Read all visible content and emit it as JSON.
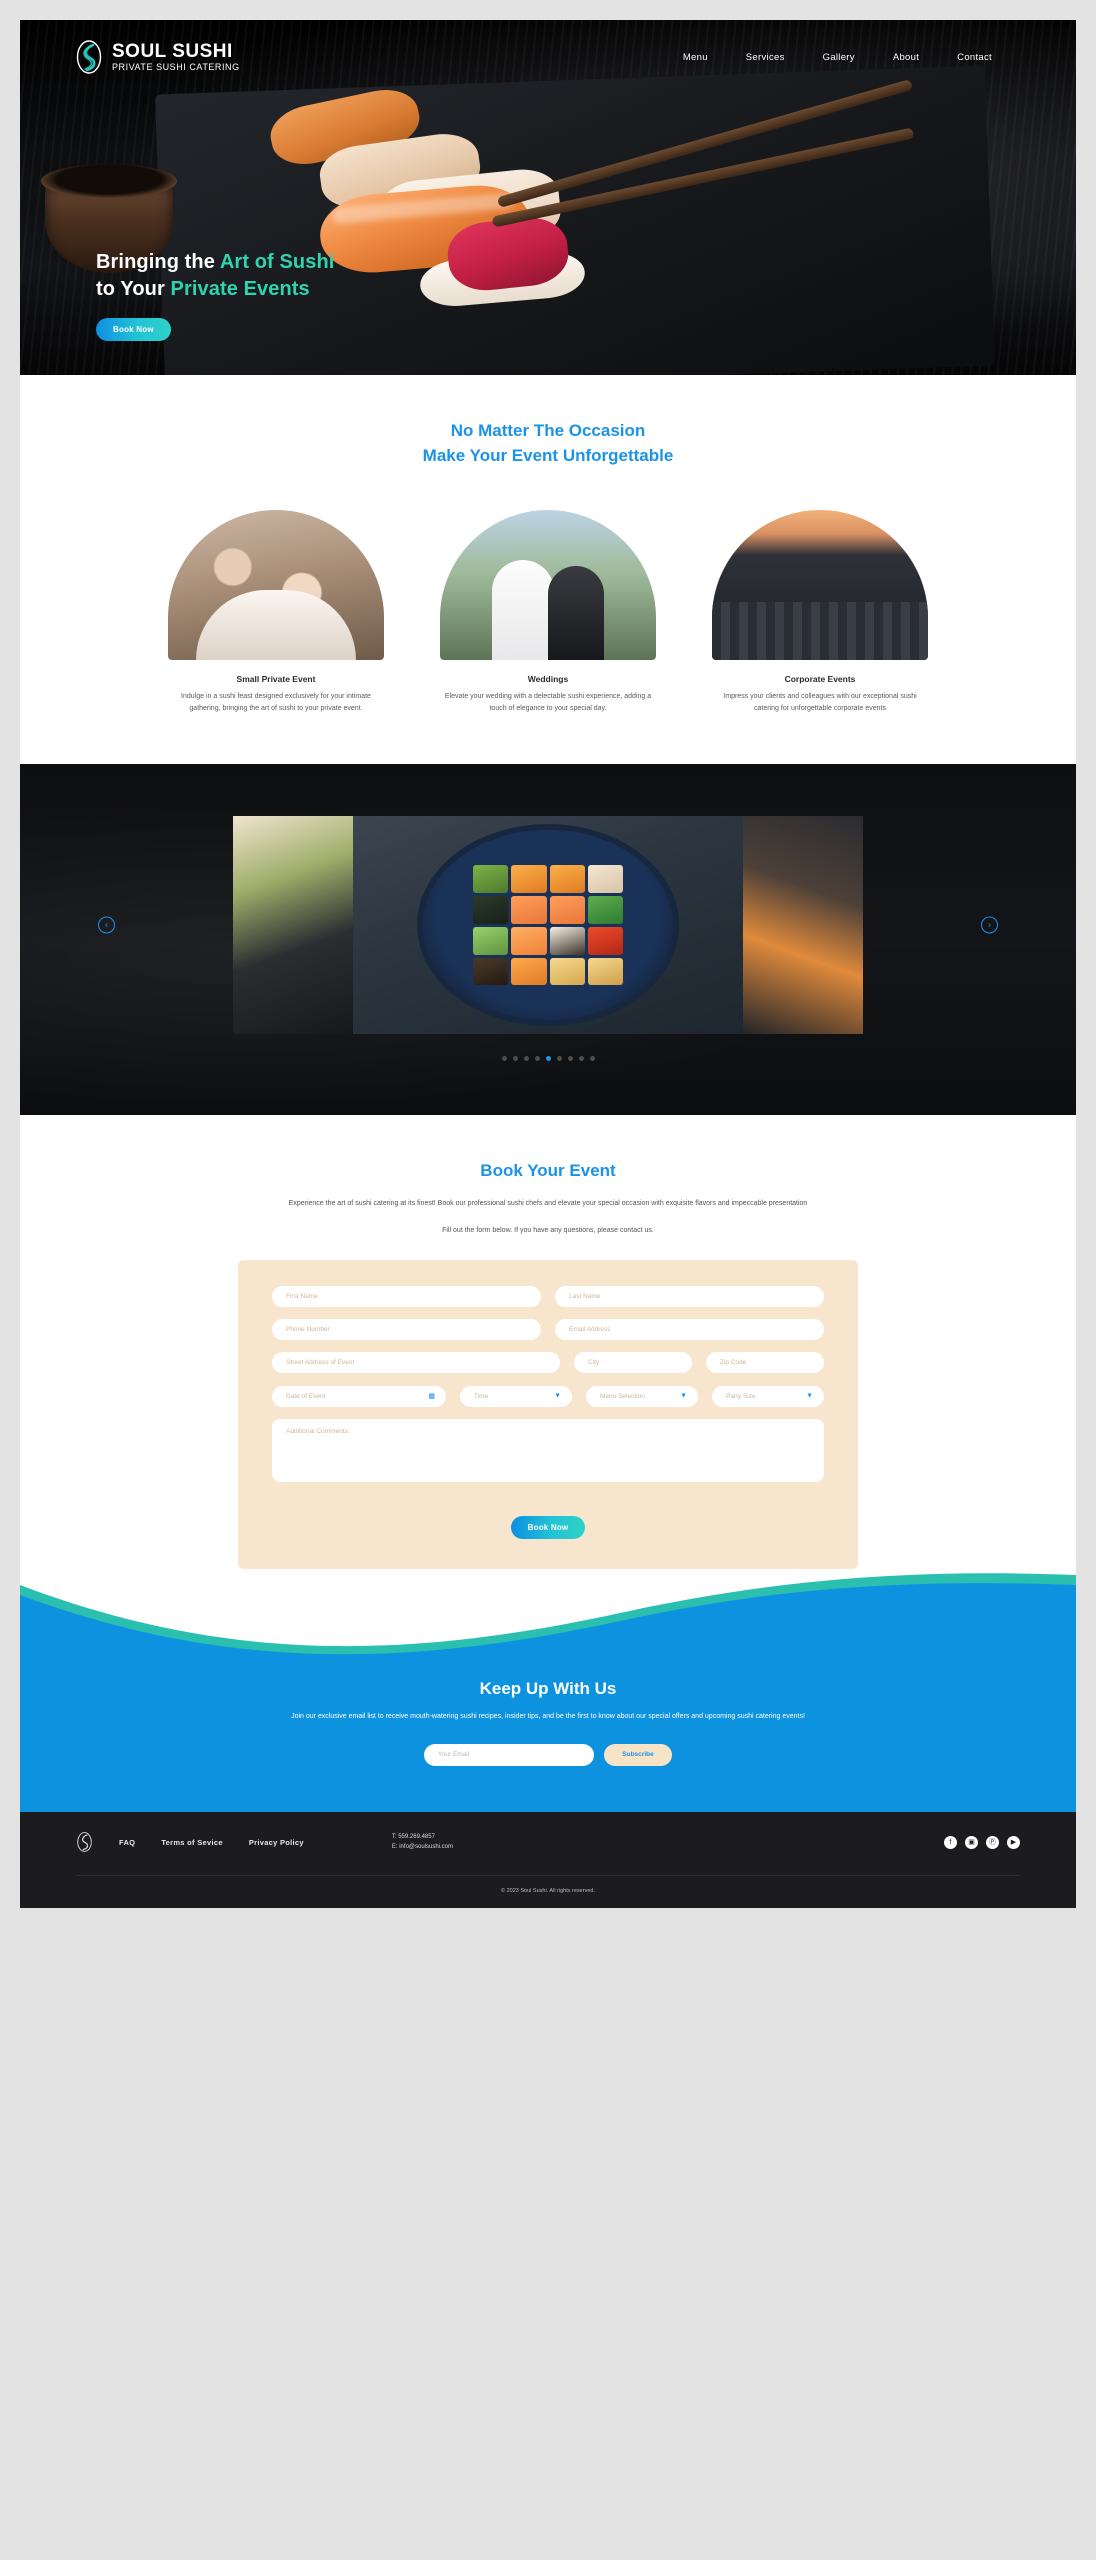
{
  "brand": {
    "name": "SOUL SUSHI",
    "tagline": "PRIVATE SUSHI CATERING",
    "logo_icon": "soul-sushi-swirl-logo"
  },
  "nav": {
    "items": [
      {
        "label": "Menu"
      },
      {
        "label": "Services"
      },
      {
        "label": "Gallery"
      },
      {
        "label": "About"
      },
      {
        "label": "Contact"
      }
    ]
  },
  "hero": {
    "line1_plain": "Bringing the ",
    "line1_accent": "Art of Sushi",
    "line2_plain": "to Your ",
    "line2_accent": "Private Events",
    "cta_label": "Book Now",
    "accent_color": "#2fd3b0"
  },
  "occasions": {
    "title_line1": "No Matter The Occasion",
    "title_line2": "Make Your Event Unforgettable",
    "title_color": "#1a93e8",
    "cards": [
      {
        "title": "Small Private Event",
        "description": "Indulge in a sushi feast designed exclusively for your intimate gathering, bringing the art of sushi to your private event."
      },
      {
        "title": "Weddings",
        "description": "Elevate your wedding with a delectable sushi experience, adding a touch of elegance to your special day."
      },
      {
        "title": "Corporate Events",
        "description": "Impress your clients and colleagues with our exceptional sushi catering for unforgettable corporate events"
      }
    ]
  },
  "gallery": {
    "prev_icon": "chevron-left-icon",
    "next_icon": "chevron-right-icon",
    "dot_count": 9,
    "active_dot_index": 4,
    "active_color": "#1a93e8"
  },
  "booking": {
    "title": "Book Your Event",
    "subtitle": "Experience the art of sushi catering at its finest! Book our professional sushi chefs and elevate your special occasion with exquisite flavors and impeccable presentation",
    "note": "Fill out the form below. If you have any questions, please contact us.",
    "form": {
      "first_name_placeholder": "First Name",
      "last_name_placeholder": "Last Name",
      "phone_placeholder": "Phone Number",
      "email_placeholder": "Email Address",
      "street_placeholder": "Street Address of Event",
      "city_placeholder": "City",
      "zip_placeholder": "Zip Code",
      "date_placeholder": "Date of Event",
      "time_placeholder": "Time",
      "menu_placeholder": "Menu Selection",
      "party_size_placeholder": "Party Size",
      "comments_placeholder": "Additional Comments:",
      "calendar_icon": "calendar-icon",
      "chevron_icon": "chevron-down-icon",
      "submit_label": "Book Now"
    }
  },
  "newsletter": {
    "title": "Keep Up With Us",
    "subtitle": "Join our exclusive email list to receive mouth-watering sushi recipes, insider tips, and be the first to know about our special offers and upcoming sushi catering events!",
    "email_placeholder": "Your Email",
    "subscribe_label": "Subscribe",
    "background_color": "#0d92e0"
  },
  "footer": {
    "logo_icon": "soul-sushi-swirl-logo",
    "links": [
      {
        "label": "FAQ"
      },
      {
        "label": "Terms of Sevice"
      },
      {
        "label": "Privacy Policy"
      }
    ],
    "phone": "T: 559.269.4857",
    "email": "E: info@soulsushi.com",
    "social": [
      {
        "icon": "facebook-icon",
        "glyph": "f"
      },
      {
        "icon": "instagram-icon",
        "glyph": "▣"
      },
      {
        "icon": "pinterest-icon",
        "glyph": "Ⓟ"
      },
      {
        "icon": "youtube-icon",
        "glyph": "▶"
      }
    ],
    "copyright": "© 2023 Soul Sushi. All rights reserved."
  }
}
